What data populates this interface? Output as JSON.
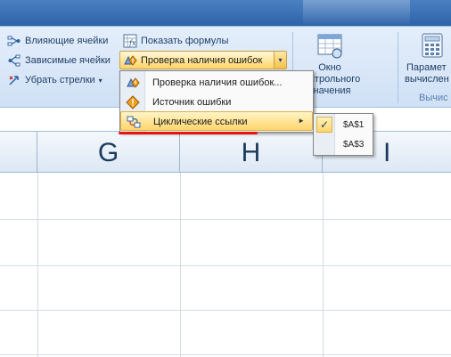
{
  "ribbon": {
    "trace_precedents": "Влияющие ячейки",
    "trace_dependents": "Зависимые ячейки",
    "remove_arrows": "Убрать стрелки",
    "remove_arrows_caret": "▾",
    "show_formulas": "Показать формулы",
    "error_checking": "Проверка наличия ошибок",
    "watch_window_line1": "Окно контрольного",
    "watch_window_line2": "значения",
    "calc_options_line1": "Парамет",
    "calc_options_line2": "вычислен",
    "calc_group_label": "Вычис"
  },
  "menu": {
    "items": [
      {
        "label": "Проверка наличия ошибок..."
      },
      {
        "label": "Источник ошибки"
      },
      {
        "label": "Циклические ссылки",
        "arrow": "►"
      }
    ]
  },
  "submenu": {
    "check": "✓",
    "items": [
      "$A$1",
      "$A$3"
    ]
  },
  "columns": [
    "G",
    "H",
    "I"
  ],
  "colors": {
    "highlight": "#ffd66b",
    "annotation": "#e31414"
  }
}
